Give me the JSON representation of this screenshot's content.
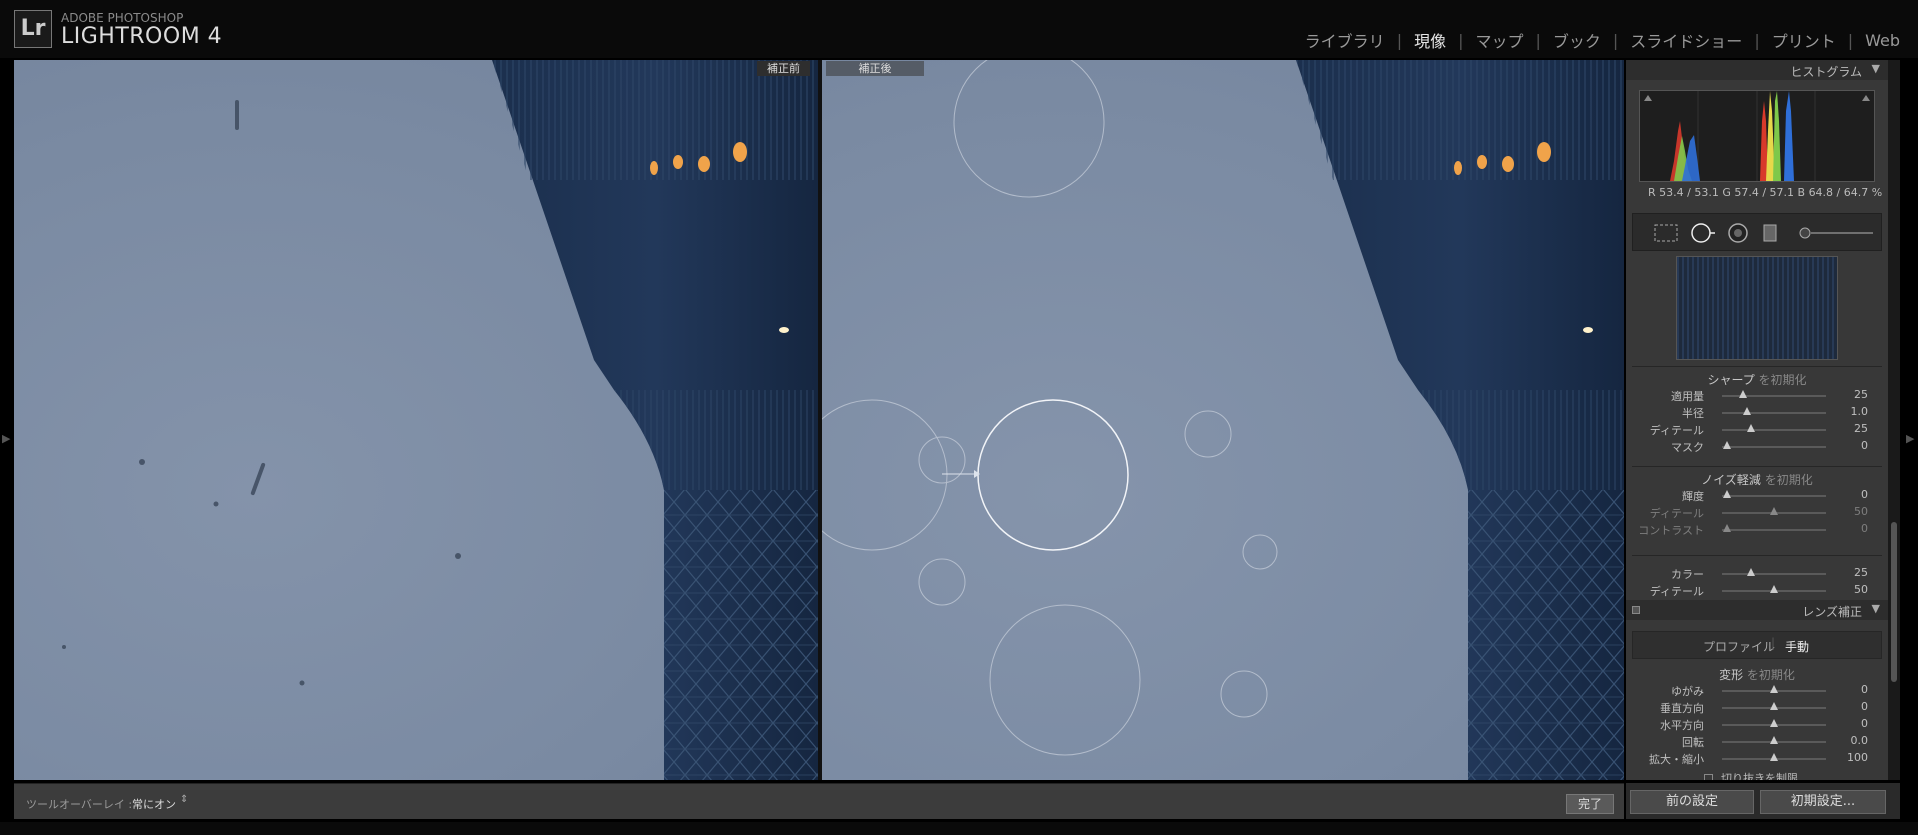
{
  "app": {
    "logo": "Lr",
    "brand_sub": "ADOBE PHOTOSHOP",
    "brand_title": "LIGHTROOM 4"
  },
  "modules": [
    {
      "label": "ライブラリ",
      "active": false
    },
    {
      "label": "現像",
      "active": true
    },
    {
      "label": "マップ",
      "active": false
    },
    {
      "label": "ブック",
      "active": false
    },
    {
      "label": "スライドショー",
      "active": false
    },
    {
      "label": "プリント",
      "active": false
    },
    {
      "label": "Web",
      "active": false
    }
  ],
  "view": {
    "before_label": "補正前",
    "after_label": "補正後"
  },
  "toolbar": {
    "overlay_label": "ツールオーバーレイ :",
    "overlay_value": "常にオン",
    "overlay_chevron": "⇕",
    "done_label": "完了"
  },
  "panel": {
    "histogram_title": "ヒストグラム",
    "rgb_readout": "R  53.4 / 53.1   G  57.4 / 57.1   B  64.8 / 64.7 %",
    "sharpen": {
      "title": "シャープ",
      "reset": "を初期化",
      "sliders": [
        {
          "label": "適用量",
          "value": "25",
          "pos": 0.2,
          "dim": false
        },
        {
          "label": "半径",
          "value": "1.0",
          "pos": 0.24,
          "dim": false
        },
        {
          "label": "ディテール",
          "value": "25",
          "pos": 0.28,
          "dim": false
        },
        {
          "label": "マスク",
          "value": "0",
          "pos": 0.05,
          "dim": false
        }
      ]
    },
    "noise": {
      "title": "ノイズ軽減",
      "reset": "を初期化",
      "sliders": [
        {
          "label": "輝度",
          "value": "0",
          "pos": 0.05,
          "dim": false
        },
        {
          "label": "ディテール",
          "value": "50",
          "pos": 0.5,
          "dim": true
        },
        {
          "label": "コントラスト",
          "value": "0",
          "pos": 0.05,
          "dim": true
        }
      ],
      "color_sliders": [
        {
          "label": "カラー",
          "value": "25",
          "pos": 0.28,
          "dim": false
        },
        {
          "label": "ディテール",
          "value": "50",
          "pos": 0.5,
          "dim": false
        }
      ]
    },
    "lens": {
      "title": "レンズ補正",
      "tab_profile": "プロファイル",
      "tab_manual": "手動",
      "transform_title": "変形",
      "transform_reset": "を初期化",
      "sliders": [
        {
          "label": "ゆがみ",
          "value": "0",
          "pos": 0.5,
          "dim": false
        },
        {
          "label": "垂直方向",
          "value": "0",
          "pos": 0.5,
          "dim": false
        },
        {
          "label": "水平方向",
          "value": "0",
          "pos": 0.5,
          "dim": false
        },
        {
          "label": "回転",
          "value": "0.0",
          "pos": 0.5,
          "dim": false
        },
        {
          "label": "拡大・縮小",
          "value": "100",
          "pos": 0.5,
          "dim": false
        }
      ],
      "crop_label": "切り抜きを制限"
    },
    "prev_settings_label": "前の設定",
    "reset_label": "初期設定..."
  }
}
